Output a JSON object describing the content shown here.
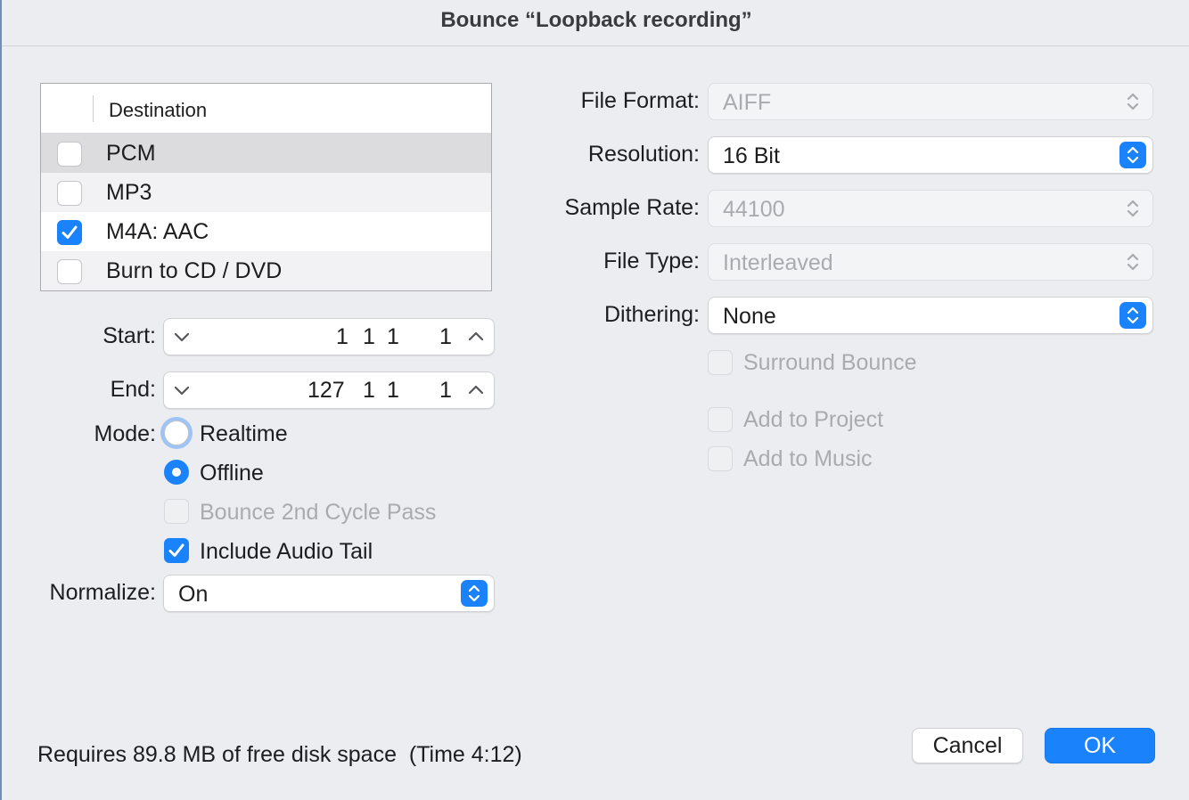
{
  "window": {
    "title": "Bounce “Loopback recording”"
  },
  "destination": {
    "header": "Destination",
    "items": [
      {
        "label": "PCM",
        "checked": false
      },
      {
        "label": "MP3",
        "checked": false
      },
      {
        "label": "M4A: AAC",
        "checked": true
      },
      {
        "label": "Burn to CD / DVD",
        "checked": false
      }
    ]
  },
  "start": {
    "label": "Start:",
    "bar": "1",
    "beat": "1",
    "division": "1",
    "tick": "1"
  },
  "end": {
    "label": "End:",
    "bar": "127",
    "beat": "1",
    "division": "1",
    "tick": "1"
  },
  "mode": {
    "label": "Mode:",
    "options": [
      {
        "label": "Realtime",
        "selected": false
      },
      {
        "label": "Offline",
        "selected": true
      }
    ]
  },
  "bounce_2nd_cycle": {
    "label": "Bounce 2nd Cycle Pass",
    "checked": false,
    "enabled": false
  },
  "include_audio_tail": {
    "label": "Include Audio Tail",
    "checked": true
  },
  "normalize": {
    "label": "Normalize:",
    "value": "On"
  },
  "file_format": {
    "label": "File Format:",
    "value": "AIFF",
    "enabled": false
  },
  "resolution": {
    "label": "Resolution:",
    "value": "16 Bit",
    "enabled": true
  },
  "sample_rate": {
    "label": "Sample Rate:",
    "value": "44100",
    "enabled": false
  },
  "file_type": {
    "label": "File Type:",
    "value": "Interleaved",
    "enabled": false
  },
  "dithering": {
    "label": "Dithering:",
    "value": "None",
    "enabled": true
  },
  "surround_bounce": {
    "label": "Surround Bounce",
    "checked": false,
    "enabled": false
  },
  "add_to_project": {
    "label": "Add to Project",
    "checked": false,
    "enabled": false
  },
  "add_to_music": {
    "label": "Add to Music",
    "checked": false,
    "enabled": false
  },
  "footer": {
    "disk_space": "Requires 89.8 MB of free disk space  (Time 4:12)",
    "cancel_label": "Cancel",
    "ok_label": "OK"
  },
  "colors": {
    "accent": "#1a82fb",
    "disabled_text": "#a9abae"
  }
}
